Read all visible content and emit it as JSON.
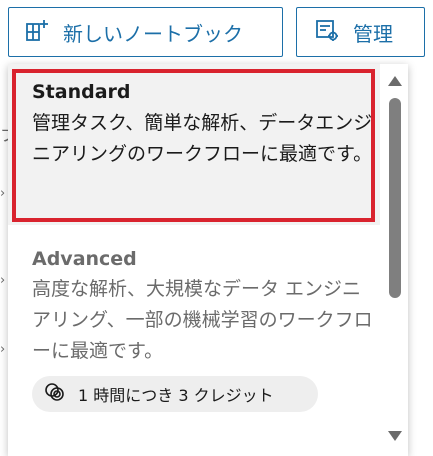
{
  "toolbar": {
    "new_notebook_label": "新しいノートブック",
    "admin_label": "管理",
    "accent_color": "#1c6fa8"
  },
  "background": {
    "partial_char": "フ"
  },
  "dropdown": {
    "options": [
      {
        "title": "Standard",
        "description": "管理タスク、簡単な解析、データエンジニアリングのワークフローに最適です。",
        "selected": true
      },
      {
        "title": "Advanced",
        "description": "高度な解析、大規模なデータ エンジニアリング、一部の機械学習のワークフローに最適です。",
        "credit_badge": "1 時間につき 3 クレジット",
        "selected": false
      }
    ],
    "highlight_color": "#d9232e"
  },
  "icons": {
    "new_notebook": "add-notebook-icon",
    "admin": "admin-settings-icon",
    "credit": "credit-coins-icon",
    "scroll_up": "triangle-up-icon",
    "scroll_down": "triangle-down-icon"
  }
}
